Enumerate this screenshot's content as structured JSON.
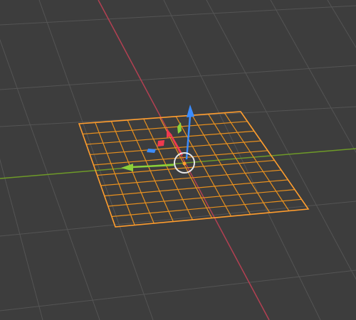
{
  "viewport": {
    "background": "#3d3d3d",
    "grid_color": "#545454",
    "x_axis_color": "#b34052",
    "y_axis_color": "#6e9a28"
  },
  "plane": {
    "object_type": "plane",
    "subdivisions": 10,
    "selected": true,
    "outline_color": "#ff9d2e",
    "wire_color": "#e8901e"
  },
  "gizmo": {
    "type": "move-gizmo",
    "x_color": "#f03a4f",
    "y_color": "#8bd13a",
    "z_color": "#3b8cff",
    "center_ring_color": "#e6e6e6"
  },
  "origin_color": "#ff9d2e"
}
